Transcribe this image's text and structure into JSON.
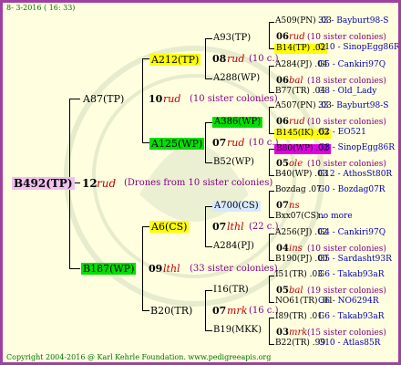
{
  "header": "8- 3-2016 ( 16: 33)",
  "footer": "Copyright 2004-2016 @ Karl Kehrle Foundation.   www.pedigreeapis.org",
  "root": {
    "name": "B492(TP)",
    "year": "12",
    "breeder": "rud",
    "note": "(Drones from 10 sister colonies)"
  },
  "dam": {
    "name": "A87(TP)",
    "year": "10",
    "breeder": "rud",
    "note": "(10 sister colonies)"
  },
  "sire": {
    "name": "B187(WP)",
    "year": "09",
    "breeder": "lthl",
    "note": "(33 sister colonies)"
  },
  "gen2": [
    {
      "name": "A212(TP)",
      "year": "08",
      "breeder": "rud",
      "note": "(10 c.)"
    },
    {
      "name": "A125(WP)",
      "year": "07",
      "breeder": "rud",
      "note": "(10 c.)"
    },
    {
      "name": "A6(CS)",
      "year": "07",
      "breeder": "lthl",
      "note": "(22 c.)"
    },
    {
      "name": "B20(TR)",
      "year": "07",
      "breeder": "mrk",
      "note": "(16 c.)"
    }
  ],
  "gen3": [
    {
      "name": "A93(TP)",
      "year": "06",
      "breeder": "rud",
      "note": "(10 sister colonies)"
    },
    {
      "name": "A288(WP)",
      "year": "06",
      "breeder": "bal",
      "note": "(18 sister colonies)"
    },
    {
      "name": "A386(WP)",
      "year": "06",
      "breeder": "rud",
      "note": "(10 sister colonies)"
    },
    {
      "name": "B52(WP)",
      "year": "05",
      "breeder": "ole",
      "note": "(10 sister colonies)"
    },
    {
      "name": "A700(CS)",
      "year": "07",
      "breeder": "ns",
      "note": ""
    },
    {
      "name": "A284(PJ)",
      "year": "04",
      "breeder": "ins",
      "note": "(10 sister colonies)"
    },
    {
      "name": "I16(TR)",
      "year": "05",
      "breeder": "bal",
      "note": "(19 sister colonies)"
    },
    {
      "name": "B19(MKK)",
      "year": "03",
      "breeder": "mrk",
      "note": "(15 sister colonies)"
    }
  ],
  "gen4": [
    {
      "name": "A509(PN) .03",
      "detail": "33 - Bayburt98-S"
    },
    {
      "name": "B14(TP) .02",
      "detail": "G10 - SinopEgg86R"
    },
    {
      "name": "A284(PJ) .04",
      "detail": "G5 - Cankiri97Q"
    },
    {
      "name": "B77(TR) .04",
      "detail": "G8 - Old_Lady"
    },
    {
      "name": "A507(PN) .03",
      "detail": "33 - Bayburt98-S"
    },
    {
      "name": "B145(IK) .03",
      "detail": "G2 - EO521"
    },
    {
      "name": "B80(WP) .02",
      "detail": "G8 - SinopEgg86R"
    },
    {
      "name": "B40(WP) .03",
      "detail": "G12 - AthosSt80R"
    },
    {
      "name": "Bozdag .07",
      "detail": "G0 - Bozdag07R"
    },
    {
      "name": "Bxx07(CS) .",
      "detail": "no more"
    },
    {
      "name": "A256(PJ) .02",
      "detail": "G4 - Cankiri97Q"
    },
    {
      "name": "B190(PJ) .00",
      "detail": "G5 - Sardasht93R"
    },
    {
      "name": "I51(TR) .03",
      "detail": "G6 - Takab93aR"
    },
    {
      "name": "NO61(TR) .01",
      "detail": "G6 - NO6294R"
    },
    {
      "name": "I89(TR) .01",
      "detail": "G6 - Takab93aR"
    },
    {
      "name": "B22(TR) .99",
      "detail": "G10 - Atlas85R"
    }
  ]
}
